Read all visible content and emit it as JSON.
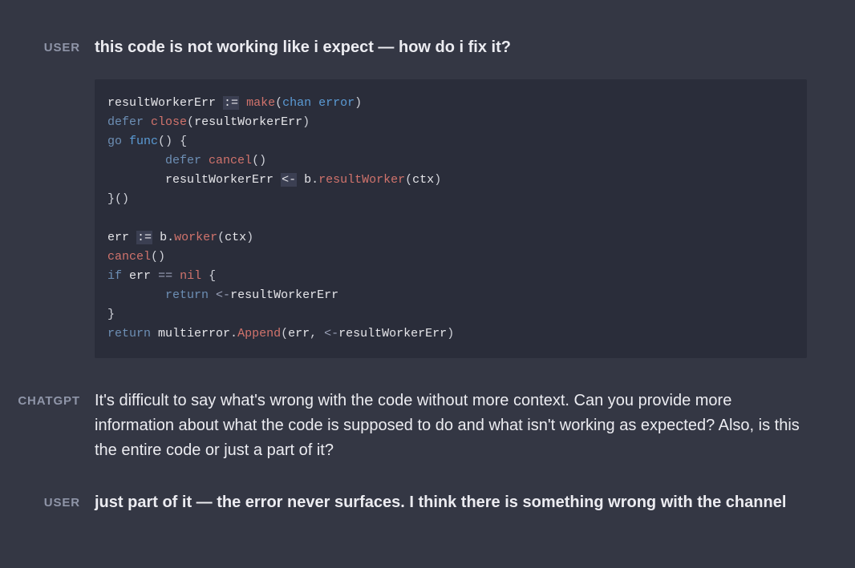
{
  "messages": [
    {
      "role_label": "USER",
      "text": "this code is not working like i expect — how do i fix it?"
    },
    {
      "role_label": "CHATGPT",
      "text": "It's difficult to say what's wrong with the code without more context. Can you provide more information about what the code is supposed to do and what isn't working as expected? Also, is this the entire code or just a part of it?"
    },
    {
      "role_label": "USER",
      "text": "just part of it — the error never surfaces. I think there is something wrong with the channel"
    }
  ],
  "code": {
    "raw": "resultWorkerErr := make(chan error)\ndefer close(resultWorkerErr)\ngo func() {\n        defer cancel()\n        resultWorkerErr <- b.resultWorker(ctx)\n}()\n\nerr := b.worker(ctx)\ncancel()\nif err == nil {\n        return <-resultWorkerErr\n}\nreturn multierror.Append(err, <-resultWorkerErr)",
    "tokens": [
      [
        [
          "ident",
          "resultWorkerErr"
        ],
        [
          "sp",
          " "
        ],
        [
          "ophl",
          ":="
        ],
        [
          "sp",
          " "
        ],
        [
          "builtin",
          "make"
        ],
        [
          "punct",
          "("
        ],
        [
          "kwtype",
          "chan"
        ],
        [
          "sp",
          " "
        ],
        [
          "kwtype",
          "error"
        ],
        [
          "punct",
          ")"
        ]
      ],
      [
        [
          "kw",
          "defer"
        ],
        [
          "sp",
          " "
        ],
        [
          "builtin",
          "close"
        ],
        [
          "punct",
          "("
        ],
        [
          "ident",
          "resultWorkerErr"
        ],
        [
          "punct",
          ")"
        ]
      ],
      [
        [
          "kw",
          "go"
        ],
        [
          "sp",
          " "
        ],
        [
          "kwtype",
          "func"
        ],
        [
          "punct",
          "()"
        ],
        [
          "sp",
          " "
        ],
        [
          "punct",
          "{"
        ]
      ],
      [
        [
          "sp",
          "        "
        ],
        [
          "kw",
          "defer"
        ],
        [
          "sp",
          " "
        ],
        [
          "builtin",
          "cancel"
        ],
        [
          "punct",
          "()"
        ]
      ],
      [
        [
          "sp",
          "        "
        ],
        [
          "ident",
          "resultWorkerErr"
        ],
        [
          "sp",
          " "
        ],
        [
          "ophl",
          "<-"
        ],
        [
          "sp",
          " "
        ],
        [
          "ident",
          "b"
        ],
        [
          "punct",
          "."
        ],
        [
          "method",
          "resultWorker"
        ],
        [
          "punct",
          "("
        ],
        [
          "ident",
          "ctx"
        ],
        [
          "punct",
          ")"
        ]
      ],
      [
        [
          "punct",
          "}()"
        ]
      ],
      [],
      [
        [
          "ident",
          "err"
        ],
        [
          "sp",
          " "
        ],
        [
          "ophl",
          ":="
        ],
        [
          "sp",
          " "
        ],
        [
          "ident",
          "b"
        ],
        [
          "punct",
          "."
        ],
        [
          "method",
          "worker"
        ],
        [
          "punct",
          "("
        ],
        [
          "ident",
          "ctx"
        ],
        [
          "punct",
          ")"
        ]
      ],
      [
        [
          "builtin",
          "cancel"
        ],
        [
          "punct",
          "()"
        ]
      ],
      [
        [
          "kw",
          "if"
        ],
        [
          "sp",
          " "
        ],
        [
          "ident",
          "err"
        ],
        [
          "sp",
          " "
        ],
        [
          "op",
          "=="
        ],
        [
          "sp",
          " "
        ],
        [
          "builtin",
          "nil"
        ],
        [
          "sp",
          " "
        ],
        [
          "punct",
          "{"
        ]
      ],
      [
        [
          "sp",
          "        "
        ],
        [
          "kw",
          "return"
        ],
        [
          "sp",
          " "
        ],
        [
          "op",
          "<-"
        ],
        [
          "ident",
          "resultWorkerErr"
        ]
      ],
      [
        [
          "punct",
          "}"
        ]
      ],
      [
        [
          "kw",
          "return"
        ],
        [
          "sp",
          " "
        ],
        [
          "ident",
          "multierror"
        ],
        [
          "punct",
          "."
        ],
        [
          "method",
          "Append"
        ],
        [
          "punct",
          "("
        ],
        [
          "ident",
          "err"
        ],
        [
          "punct",
          ","
        ],
        [
          "sp",
          " "
        ],
        [
          "op",
          "<-"
        ],
        [
          "ident",
          "resultWorkerErr"
        ],
        [
          "punct",
          ")"
        ]
      ]
    ]
  }
}
